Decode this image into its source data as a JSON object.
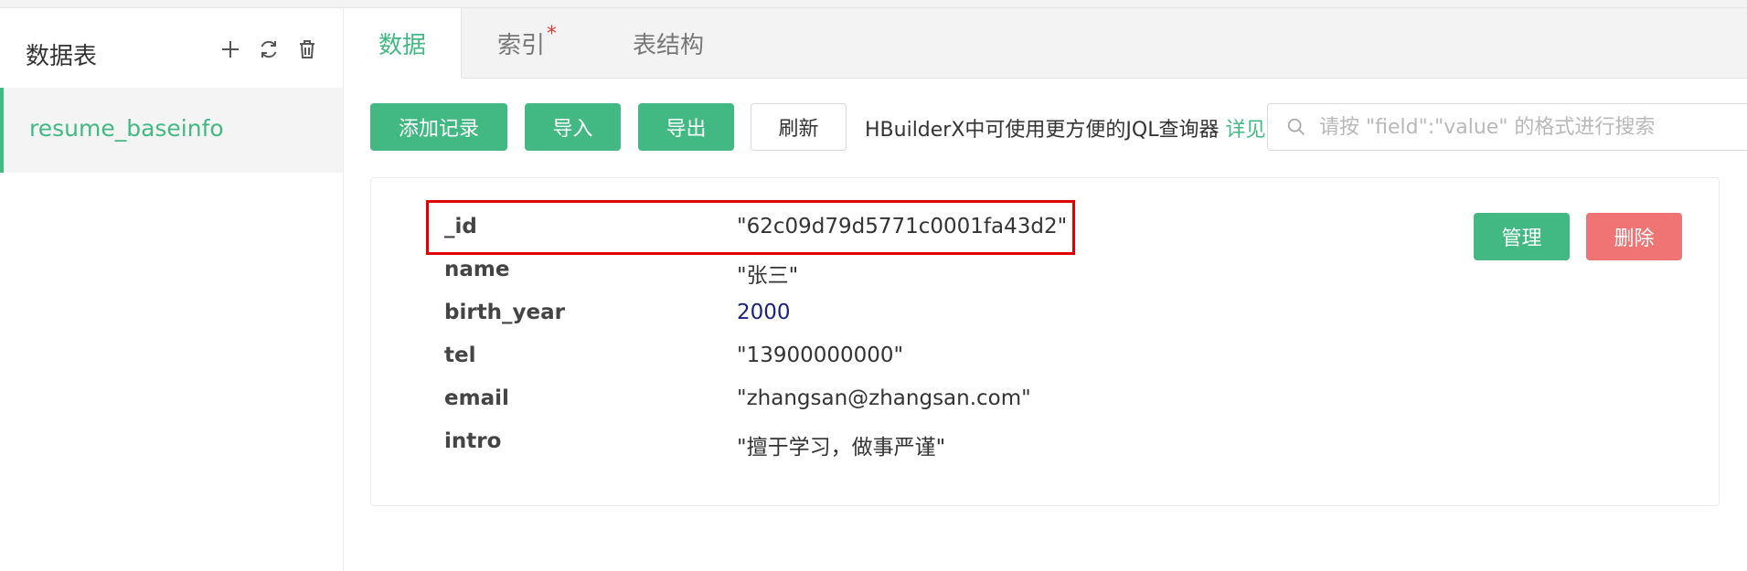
{
  "sidebar": {
    "title": "数据表",
    "actions": [
      "add-icon",
      "refresh-icon",
      "trash-icon"
    ],
    "items": [
      {
        "label": "resume_baseinfo",
        "active": true
      }
    ]
  },
  "tabs": [
    {
      "label": "数据",
      "active": true
    },
    {
      "label": "索引",
      "starred": true,
      "star": "*"
    },
    {
      "label": "表结构"
    }
  ],
  "toolbar": {
    "add_label": "添加记录",
    "import_label": "导入",
    "export_label": "导出",
    "refresh_label": "刷新",
    "hint_text": "HBuilderX中可使用更方便的JQL查询器 ",
    "hint_link": "详见",
    "search_placeholder": "请按 \"field\":\"value\" 的格式进行搜索"
  },
  "record": {
    "fields": [
      {
        "key": "_id",
        "value": "\"62c09d79d5771c0001fa43d2\"",
        "type": "string"
      },
      {
        "key": "name",
        "value": "\"张三\"",
        "type": "string"
      },
      {
        "key": "birth_year",
        "value": "2000",
        "type": "number"
      },
      {
        "key": "tel",
        "value": "\"13900000000\"",
        "type": "string"
      },
      {
        "key": "email",
        "value": "\"zhangsan@zhangsan.com\"",
        "type": "string"
      },
      {
        "key": "intro",
        "value": "\"擅于学习，做事严谨\"",
        "type": "string"
      }
    ],
    "manage_label": "管理",
    "delete_label": "删除"
  },
  "colors": {
    "accent": "#42b983",
    "danger": "#f07474",
    "highlight": "#e00000",
    "number": "#1a237e"
  }
}
